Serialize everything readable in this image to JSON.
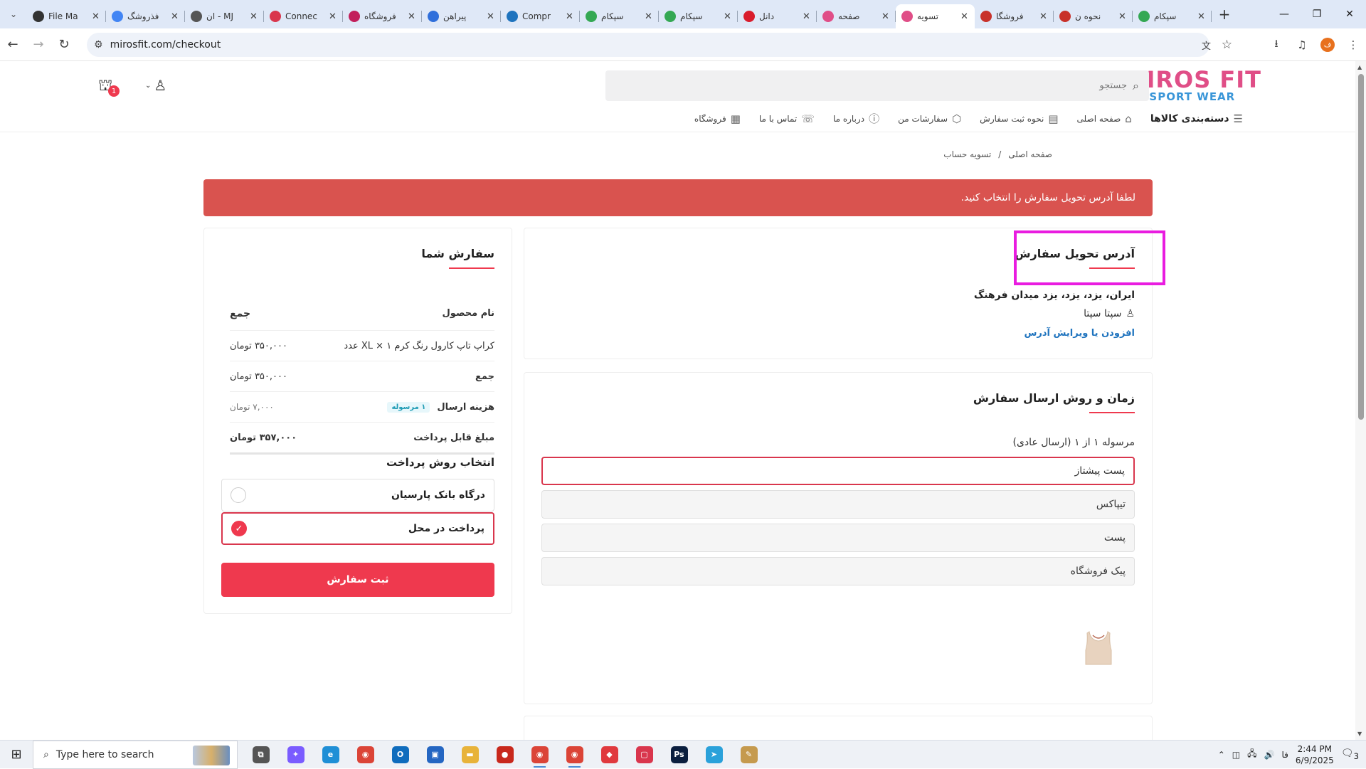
{
  "browser": {
    "tabs": [
      {
        "title": "File Ma",
        "favicon_color": "#333"
      },
      {
        "title": "فذروشگ",
        "favicon_color": "#4285f4"
      },
      {
        "title": "MJ - ان",
        "favicon_color": "#555"
      },
      {
        "title": "Connec",
        "favicon_color": "#d9364d"
      },
      {
        "title": "فروشگاه",
        "favicon_color": "#c21f5b"
      },
      {
        "title": "پیراهن",
        "favicon_color": "#2f6fdb"
      },
      {
        "title": "Compr",
        "favicon_color": "#1e73be"
      },
      {
        "title": "سپکام",
        "favicon_color": "#34a853"
      },
      {
        "title": "سپکام",
        "favicon_color": "#34a853"
      },
      {
        "title": "دانل",
        "favicon_color": "#d91c2c"
      },
      {
        "title": "صفحه",
        "favicon_color": "#e04e87"
      },
      {
        "title": "تسویه",
        "favicon_color": "#e04e87"
      },
      {
        "title": "فروشگا",
        "favicon_color": "#c8312a"
      },
      {
        "title": "نحوه ن",
        "favicon_color": "#c8312a"
      },
      {
        "title": "سپکام",
        "favicon_color": "#34a853"
      }
    ],
    "active_tab_index": 11,
    "url": "mirosfit.com/checkout",
    "profile_initial": "ف"
  },
  "site": {
    "logo_top": "MIROS FIT",
    "logo_bottom": "SPORT WEAR",
    "search_placeholder": "جستجو",
    "cart_count": "1",
    "menu": [
      {
        "label": "دسته‌بندی کالاها",
        "icon": "☰"
      },
      {
        "label": "صفحه اصلی",
        "icon": "⌂"
      },
      {
        "label": "نحوه ثبت سفارش",
        "icon": "▤"
      },
      {
        "label": "سفارشات من",
        "icon": "⬡"
      },
      {
        "label": "درباره ما",
        "icon": "ⓘ"
      },
      {
        "label": "تماس با ما",
        "icon": "☏"
      },
      {
        "label": "فروشگاه",
        "icon": "▦"
      }
    ],
    "breadcrumb": {
      "home": "صفحه اصلی",
      "sep": "/",
      "current": "تسویه حساب"
    }
  },
  "checkout": {
    "alert": "لطفا آدرس تحویل سفارش را انتخاب کنید.",
    "address": {
      "title": "آدرس تحویل سفارش",
      "line": "ایران، یزد، یزد، یزد میدان فرهنگ",
      "name": "سپتا سپتا",
      "edit_link": "افزودن یا ویرایش آدرس"
    },
    "shipping": {
      "title": "زمان و روش ارسال سفارش",
      "subtitle": "مرسوله ۱ از ۱ (ارسال عادی)",
      "options": [
        "پست پیشتاز",
        "تیپاکس",
        "پست",
        "پیک فروشگاه"
      ],
      "selected_index": 0
    },
    "next_section_partial": "",
    "order": {
      "title": "سفارش شما",
      "col_product": "نام محصول",
      "col_total": "جمع",
      "item_name": "کراپ تاپ کارول رنگ کرم XL × ۱ عدد",
      "item_price": "۳۵۰,۰۰۰ تومان",
      "subtotal_label": "جمع",
      "subtotal_value": "۳۵۰,۰۰۰ تومان",
      "shipping_label": "هزینه ارسال",
      "shipping_badge": "۱ مرسوله",
      "shipping_value": "۷,۰۰۰ تومان",
      "payable_label": "مبلغ قابل پرداخت",
      "payable_value": "۳۵۷,۰۰۰ تومان"
    },
    "payment": {
      "title": "انتخاب روش پرداخت",
      "options": [
        "درگاه بانک پارسیان",
        "پرداخت در محل"
      ],
      "selected_index": 1
    },
    "submit_label": "ثبت سفارش"
  },
  "taskbar": {
    "search_placeholder": "Type here to search",
    "time": "2:44 PM",
    "date": "6/9/2025",
    "lang": "فا",
    "notifications": "3",
    "apps": [
      {
        "name": "task-view",
        "color": "#555",
        "glyph": "⧉"
      },
      {
        "name": "copilot",
        "color": "#7a5cff",
        "glyph": "✦"
      },
      {
        "name": "edge",
        "color": "#1f8fd6",
        "glyph": "e"
      },
      {
        "name": "chrome",
        "color": "#db4437",
        "glyph": "◉"
      },
      {
        "name": "outlook",
        "color": "#0f6cbd",
        "glyph": "O"
      },
      {
        "name": "store",
        "color": "#2466c2",
        "glyph": "▣"
      },
      {
        "name": "explorer",
        "color": "#e8b33a",
        "glyph": "▬"
      },
      {
        "name": "app-red",
        "color": "#c8281c",
        "glyph": "●"
      },
      {
        "name": "chrome-profile",
        "color": "#db4437",
        "glyph": "◉"
      },
      {
        "name": "chrome-profile-2",
        "color": "#db4437",
        "glyph": "◉"
      },
      {
        "name": "anydesk",
        "color": "#e0393e",
        "glyph": "◆"
      },
      {
        "name": "app-box",
        "color": "#d9364d",
        "glyph": "▢"
      },
      {
        "name": "photoshop",
        "color": "#0b1f3f",
        "glyph": "Ps"
      },
      {
        "name": "telegram",
        "color": "#2aa1da",
        "glyph": "➤"
      },
      {
        "name": "paint",
        "color": "#c59a4e",
        "glyph": "✎"
      }
    ]
  }
}
